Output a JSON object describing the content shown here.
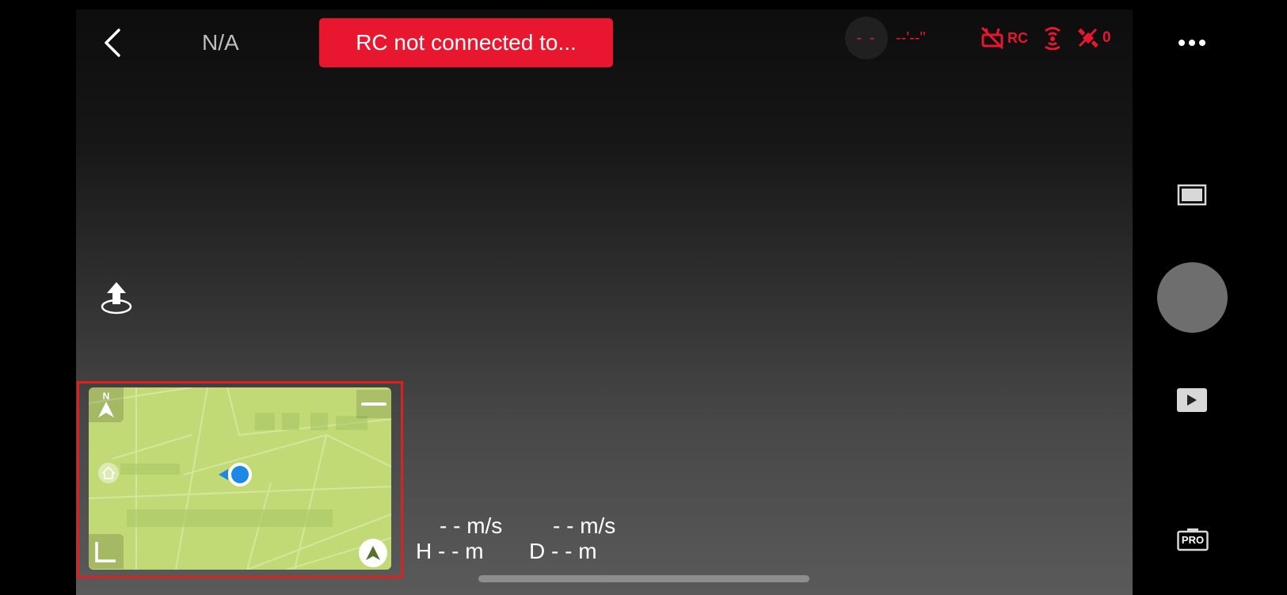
{
  "topbar": {
    "back_icon": "chevron-left-icon",
    "mode_label": "N/A",
    "warning_text": "RC not connected to...",
    "battery_text": "- -",
    "flight_time": "--'--\"",
    "rc_label": "RC",
    "satellite_count": "0",
    "more_icon": "more-dots-icon",
    "alert_color": "#e8162e"
  },
  "left_controls": {
    "takeoff_icon": "takeoff-icon"
  },
  "minimap": {
    "north_label": "N",
    "border_color": "#e01f1f",
    "map_color": "#c2da76",
    "drone_marker_color": "#1e88e5"
  },
  "telemetry": {
    "h_speed": "- - m/s",
    "v_speed": "- - m/s",
    "height": "H - - m",
    "distance": "D - - m"
  },
  "right_controls": {
    "ratio_icon": "aspect-ratio-icon",
    "shutter_icon": "shutter-button",
    "playback_icon": "playback-icon",
    "pro_label": "PRO"
  }
}
